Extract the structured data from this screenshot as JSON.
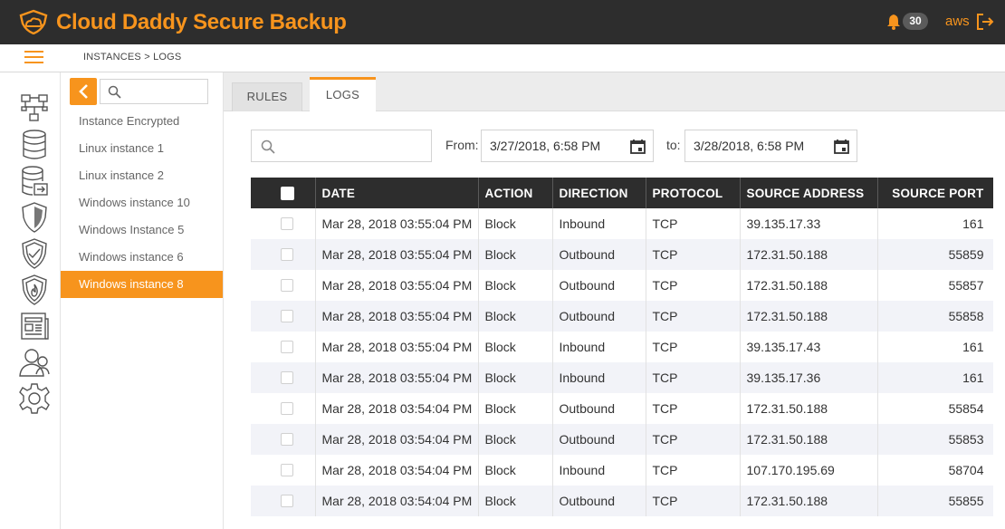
{
  "app": {
    "title": "Cloud Daddy Secure Backup",
    "notification_count": "30",
    "account": "aws",
    "accent_color": "#f7941d",
    "header_bg": "#2d2d2d"
  },
  "breadcrumb": "INSTANCES > LOGS",
  "rail_icons": [
    "network-icon",
    "database-icon",
    "database-export-icon",
    "shield-icon",
    "shield-check-icon",
    "shield-fire-icon",
    "newspaper-icon",
    "user-support-icon",
    "gear-icon"
  ],
  "instances": {
    "search_placeholder": "",
    "items": [
      {
        "label": "Instance Encrypted",
        "active": false
      },
      {
        "label": "Linux instance 1",
        "active": false
      },
      {
        "label": "Linux instance 2",
        "active": false
      },
      {
        "label": "Windows instance 10",
        "active": false
      },
      {
        "label": "Windows Instance 5",
        "active": false
      },
      {
        "label": "Windows instance 6",
        "active": false
      },
      {
        "label": "Windows instance 8",
        "active": true
      }
    ]
  },
  "tabs": [
    {
      "label": "RULES",
      "active": false
    },
    {
      "label": "LOGS",
      "active": true
    }
  ],
  "filters": {
    "search_value": "",
    "from_label": "From:",
    "from_value": "3/27/2018, 6:58 PM",
    "to_label": "to:",
    "to_value": "3/28/2018, 6:58 PM"
  },
  "table": {
    "columns": [
      "DATE",
      "ACTION",
      "DIRECTION",
      "PROTOCOL",
      "SOURCE ADDRESS",
      "SOURCE PORT"
    ],
    "rows": [
      {
        "date": "Mar 28, 2018 03:55:04 PM",
        "action": "Block",
        "direction": "Inbound",
        "protocol": "TCP",
        "source_address": "39.135.17.33",
        "source_port": "161"
      },
      {
        "date": "Mar 28, 2018 03:55:04 PM",
        "action": "Block",
        "direction": "Outbound",
        "protocol": "TCP",
        "source_address": "172.31.50.188",
        "source_port": "55859"
      },
      {
        "date": "Mar 28, 2018 03:55:04 PM",
        "action": "Block",
        "direction": "Outbound",
        "protocol": "TCP",
        "source_address": "172.31.50.188",
        "source_port": "55857"
      },
      {
        "date": "Mar 28, 2018 03:55:04 PM",
        "action": "Block",
        "direction": "Outbound",
        "protocol": "TCP",
        "source_address": "172.31.50.188",
        "source_port": "55858"
      },
      {
        "date": "Mar 28, 2018 03:55:04 PM",
        "action": "Block",
        "direction": "Inbound",
        "protocol": "TCP",
        "source_address": "39.135.17.43",
        "source_port": "161"
      },
      {
        "date": "Mar 28, 2018 03:55:04 PM",
        "action": "Block",
        "direction": "Inbound",
        "protocol": "TCP",
        "source_address": "39.135.17.36",
        "source_port": "161"
      },
      {
        "date": "Mar 28, 2018 03:54:04 PM",
        "action": "Block",
        "direction": "Outbound",
        "protocol": "TCP",
        "source_address": "172.31.50.188",
        "source_port": "55854"
      },
      {
        "date": "Mar 28, 2018 03:54:04 PM",
        "action": "Block",
        "direction": "Outbound",
        "protocol": "TCP",
        "source_address": "172.31.50.188",
        "source_port": "55853"
      },
      {
        "date": "Mar 28, 2018 03:54:04 PM",
        "action": "Block",
        "direction": "Inbound",
        "protocol": "TCP",
        "source_address": "107.170.195.69",
        "source_port": "58704"
      },
      {
        "date": "Mar 28, 2018 03:54:04 PM",
        "action": "Block",
        "direction": "Outbound",
        "protocol": "TCP",
        "source_address": "172.31.50.188",
        "source_port": "55855"
      }
    ]
  }
}
